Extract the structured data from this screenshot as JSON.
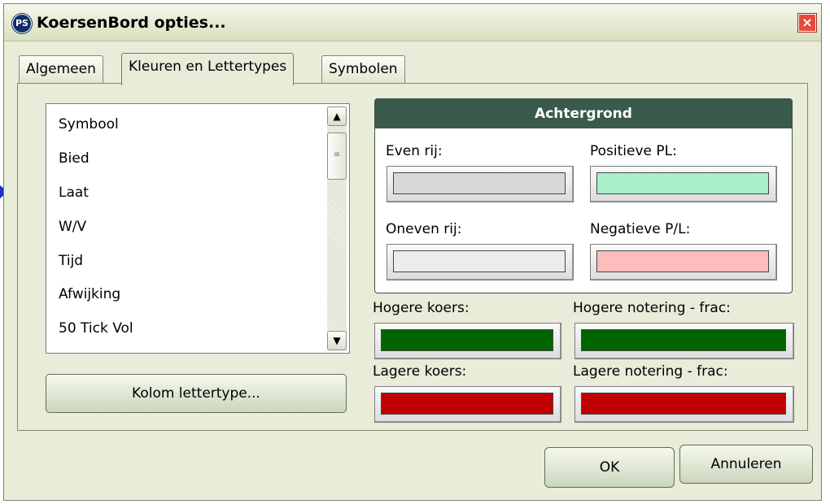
{
  "window": {
    "title": "KoersenBord opties...",
    "icon": "ps-app-icon",
    "close_glyph": "×"
  },
  "tabs": [
    {
      "label": "Algemeen",
      "active": false
    },
    {
      "label": "Kleuren en Lettertypes",
      "active": true
    },
    {
      "label": "Symbolen",
      "active": false
    }
  ],
  "columns_list": {
    "items": [
      "Symbool",
      "Bied",
      "Laat",
      "W/V",
      "Tijd",
      "Afwijking",
      "50 Tick Vol"
    ],
    "scroll_up_icon": "chevron-up-icon",
    "scroll_down_icon": "chevron-down-icon"
  },
  "font_button_label": "Kolom lettertype...",
  "background_group": {
    "title": "Achtergrond",
    "even_row": {
      "label": "Even rij:",
      "color": "#d8d8d8"
    },
    "positive_pl": {
      "label": "Positieve PL:",
      "color": "#a8f0c8"
    },
    "odd_row": {
      "label": "Oneven rij:",
      "color": "#ececec"
    },
    "negative_pl": {
      "label": "Negatieve P/L:",
      "color": "#ffbcbc"
    }
  },
  "price_colors": {
    "higher_price": {
      "label": "Hogere koers:",
      "color": "#006400"
    },
    "higher_quote_frac": {
      "label": "Hogere notering - frac:",
      "color": "#006400"
    },
    "lower_price": {
      "label": "Lagere koers:",
      "color": "#c00000"
    },
    "lower_quote_frac": {
      "label": "Lagere notering - frac:",
      "color": "#c00000"
    }
  },
  "buttons": {
    "ok": "OK",
    "cancel": "Annuleren"
  }
}
